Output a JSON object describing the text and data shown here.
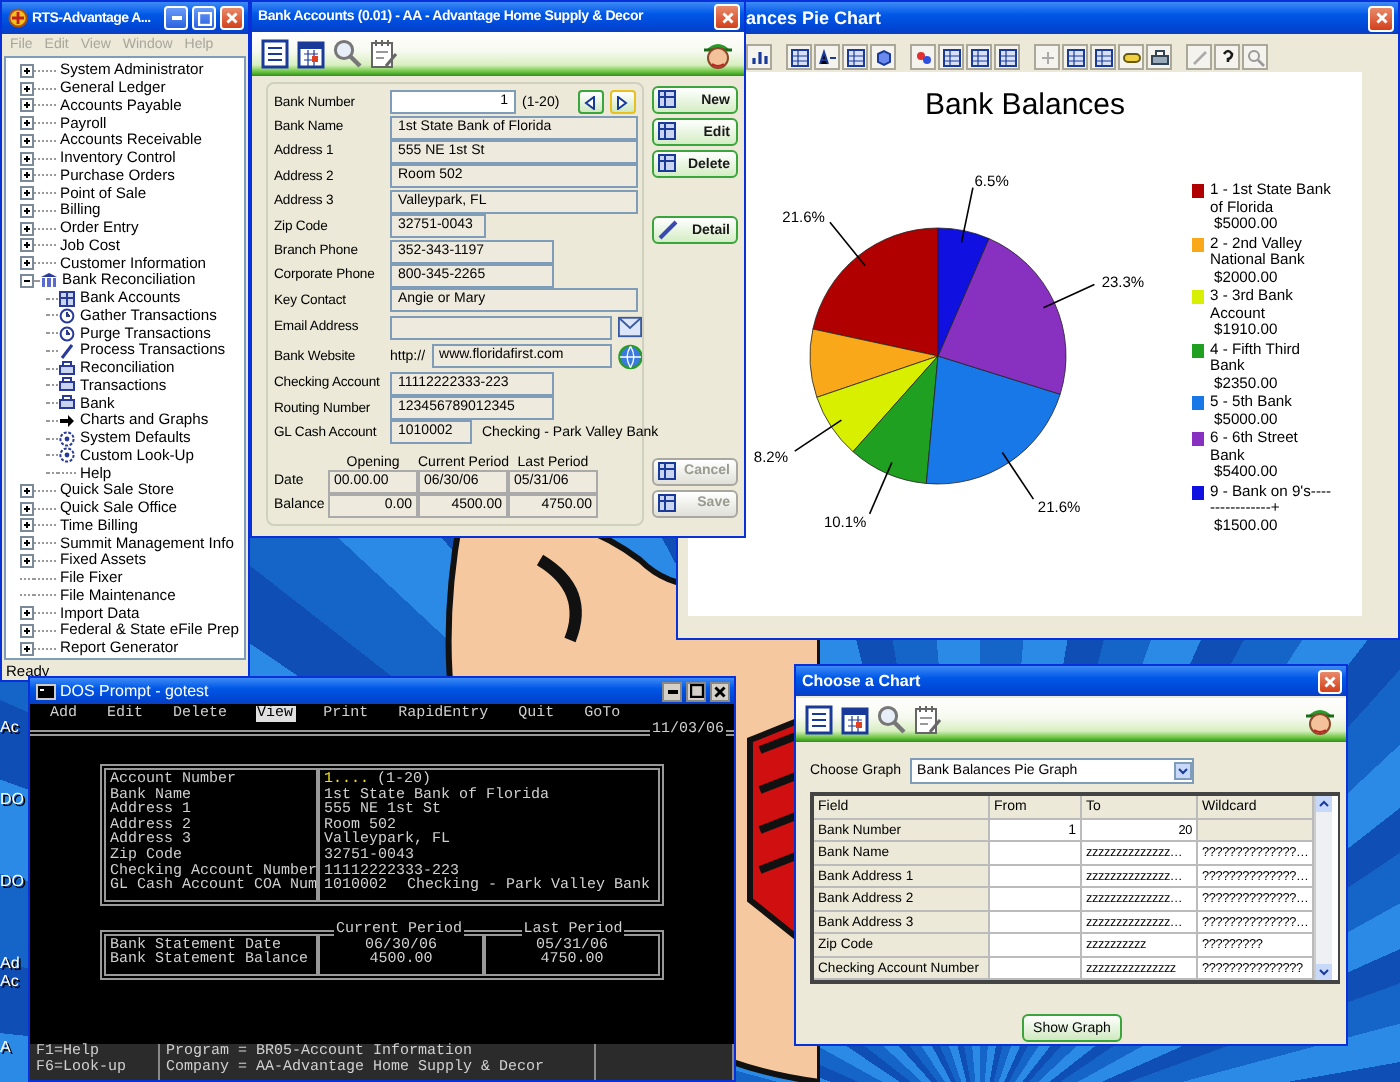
{
  "desktop_icons": [
    {
      "label": "Ac"
    },
    {
      "label": "DO"
    },
    {
      "label": "DO"
    },
    {
      "label": "Ad"
    },
    {
      "label": "Ac"
    },
    {
      "label": "A"
    }
  ],
  "main_window": {
    "title": "RTS-Advantage A...",
    "menu": [
      {
        "label": "File",
        "disabled": true
      },
      {
        "label": "Edit",
        "disabled": true
      },
      {
        "label": "View",
        "disabled": true
      },
      {
        "label": "Window",
        "disabled": true
      },
      {
        "label": "Help",
        "disabled": true
      }
    ],
    "tree": [
      {
        "label": "System Administrator",
        "kind": "folder",
        "expanded": false
      },
      {
        "label": "General Ledger",
        "kind": "folder",
        "expanded": false
      },
      {
        "label": "Accounts Payable",
        "kind": "folder",
        "expanded": false
      },
      {
        "label": "Payroll",
        "kind": "folder",
        "expanded": false
      },
      {
        "label": "Accounts Receivable",
        "kind": "folder",
        "expanded": false
      },
      {
        "label": "Inventory Control",
        "kind": "folder",
        "expanded": false
      },
      {
        "label": "Purchase Orders",
        "kind": "folder",
        "expanded": false
      },
      {
        "label": "Point of Sale",
        "kind": "folder",
        "expanded": false
      },
      {
        "label": "Billing",
        "kind": "folder",
        "expanded": false
      },
      {
        "label": "Order Entry",
        "kind": "folder",
        "expanded": false
      },
      {
        "label": "Job Cost",
        "kind": "folder",
        "expanded": false
      },
      {
        "label": "Customer Information",
        "kind": "folder",
        "expanded": false
      },
      {
        "label": "Bank Reconciliation",
        "kind": "folder",
        "expanded": true,
        "children": [
          {
            "label": "Bank Accounts"
          },
          {
            "label": "Gather Transactions"
          },
          {
            "label": "Purge Transactions"
          },
          {
            "label": "Process Transactions"
          },
          {
            "label": "Reconciliation"
          },
          {
            "label": "Transactions"
          },
          {
            "label": "Bank"
          },
          {
            "label": "Charts and Graphs"
          },
          {
            "label": "System Defaults"
          },
          {
            "label": "Custom Look-Up"
          },
          {
            "label": "Help"
          }
        ]
      },
      {
        "label": "Quick Sale Store",
        "kind": "folder",
        "expanded": false
      },
      {
        "label": "Quick Sale Office",
        "kind": "folder",
        "expanded": false
      },
      {
        "label": "Time Billing",
        "kind": "folder",
        "expanded": false
      },
      {
        "label": "Summit Management Info",
        "kind": "folder",
        "expanded": false
      },
      {
        "label": "Fixed Assets",
        "kind": "folder",
        "expanded": false
      },
      {
        "label": "File Fixer",
        "kind": "leaf",
        "expanded": false
      },
      {
        "label": "File Maintenance",
        "kind": "leaf",
        "expanded": false
      },
      {
        "label": "Import Data",
        "kind": "folder",
        "expanded": false
      },
      {
        "label": "Federal & State eFile Prep",
        "kind": "folder",
        "expanded": false
      },
      {
        "label": "Report Generator",
        "kind": "folder",
        "expanded": false
      }
    ],
    "status": "Ready"
  },
  "bank_window": {
    "title": "Bank Accounts (0.01) - AA - Advantage Home Supply & Decor",
    "fields": [
      {
        "kind": "number",
        "label": "Bank Number",
        "value": "1",
        "range": "(1-20)"
      },
      {
        "kind": "text",
        "label": "Bank Name",
        "value": "1st State Bank of Florida"
      },
      {
        "kind": "text",
        "label": "Address 1",
        "value": "555 NE 1st St"
      },
      {
        "kind": "text",
        "label": "Address 2",
        "value": "Room 502"
      },
      {
        "kind": "text",
        "label": "Address 3",
        "value": "Valleypark, FL"
      },
      {
        "kind": "short",
        "label": "Zip Code",
        "value": "32751-0043"
      },
      {
        "kind": "medium",
        "label": "Branch Phone",
        "value": "352-343-1197"
      },
      {
        "kind": "medium",
        "label": "Corporate Phone",
        "value": "800-345-2265"
      },
      {
        "kind": "text",
        "label": "Key Contact",
        "value": "Angie or Mary"
      },
      {
        "kind": "email",
        "label": "Email Address"
      },
      {
        "kind": "website",
        "label": "Bank Website",
        "prefix": "http://",
        "value": "www.floridafirst.com"
      },
      {
        "kind": "medium",
        "label": "Checking Account",
        "value": "11112222333-223"
      },
      {
        "kind": "medium",
        "label": "Routing Number",
        "value": "123456789012345"
      },
      {
        "kind": "account",
        "label": "GL Cash Account",
        "value": "1010002",
        "note": "Checking - Park Valley Bank"
      }
    ],
    "buttons": [
      {
        "label": "New",
        "disabled": false
      },
      {
        "label": "Edit",
        "disabled": false
      },
      {
        "label": "Delete",
        "disabled": false
      },
      {
        "label": "Detail",
        "disabled": false
      }
    ],
    "period_table": {
      "columns": [
        "Opening",
        "Current Period",
        "Last Period"
      ],
      "rows": [
        {
          "label": "Date",
          "values": [
            "00.00.00",
            "06/30/06",
            "05/31/06"
          ]
        },
        {
          "label": "Balance",
          "values": [
            "0.00",
            "4500.00",
            "4750.00"
          ]
        }
      ]
    },
    "footer_buttons": [
      {
        "label": "Cancel",
        "disabled": true
      },
      {
        "label": "Save",
        "disabled": true
      }
    ]
  },
  "chart_window": {
    "title": "ances Pie Chart",
    "chart_data": {
      "type": "pie",
      "title": "Bank Balances",
      "categories": [
        "1 - 1st State Bank of Florida",
        "2 - 2nd Valley National Bank",
        "3 - 3rd Bank Account",
        "4 - Fifth Third Bank",
        "5 - 5th Bank",
        "6 - 6th Street Bank",
        "9 - Bank on 9's----------------+"
      ],
      "values": [
        21.6,
        8.6,
        8.2,
        10.1,
        21.6,
        23.3,
        6.5
      ],
      "value_labels": [
        "21.6%",
        null,
        "8.2%",
        "10.1%",
        "21.6%",
        "23.3%",
        "6.5%"
      ]
    },
    "legend": [
      {
        "color": "#b00000",
        "amount": "$5000.00"
      },
      {
        "color": "#f8a818",
        "amount": "$2000.00"
      },
      {
        "color": "#d8f000",
        "amount": "$1910.00"
      },
      {
        "color": "#20a020",
        "amount": "$2350.00"
      },
      {
        "color": "#1878e8",
        "amount": "$5000.00"
      },
      {
        "color": "#8830c0",
        "amount": "$5400.00"
      },
      {
        "color": "#1010e0",
        "amount": "$1500.00"
      }
    ]
  },
  "dos_window": {
    "title": "DOS Prompt - gotest",
    "menu": [
      {
        "label": "Add",
        "selected": false
      },
      {
        "label": "Edit",
        "selected": false
      },
      {
        "label": "Delete",
        "selected": false
      },
      {
        "label": "View",
        "selected": true
      },
      {
        "label": "Print",
        "selected": false
      },
      {
        "label": "RapidEntry",
        "selected": false
      },
      {
        "label": "Quit",
        "selected": false
      },
      {
        "label": "GoTo",
        "selected": false
      }
    ],
    "date": "11/03/06",
    "record": [
      {
        "label": "Account Number",
        "value": "1....",
        "note": "(1-20)",
        "active": true
      },
      {
        "label": "Bank Name",
        "value": "1st State Bank of Florida",
        "active": false
      },
      {
        "label": "Address 1",
        "value": "555 NE 1st St",
        "active": false
      },
      {
        "label": "Address 2",
        "value": "Room 502",
        "active": false
      },
      {
        "label": "Address 3",
        "value": "Valleypark, FL",
        "active": false
      },
      {
        "label": "Zip Code",
        "value": "32751-0043",
        "active": false
      },
      {
        "label": "Checking Account Number",
        "value": "11112222333-223",
        "active": false
      },
      {
        "label": "GL Cash Account COA Num",
        "value": "1010002",
        "note": "Checking - Park Valley Bank",
        "active": false
      }
    ],
    "statement": {
      "columns": [
        "Current Period",
        "Last Period"
      ],
      "rows": [
        {
          "label": "Bank Statement Date",
          "values": [
            "06/30/06",
            "05/31/06"
          ]
        },
        {
          "label": "Bank Statement Balance",
          "values": [
            "4500.00",
            "4750.00"
          ]
        }
      ]
    },
    "keys": [
      "F1=Help",
      "F6=Look-up"
    ],
    "info": [
      "Program = BR05-Account Information",
      "Company = AA-Advantage Home Supply & Decor"
    ]
  },
  "choose_chart_window": {
    "title": "Choose a Chart",
    "graph_label": "Choose Graph",
    "graph_value": "Bank Balances Pie Graph",
    "columns": [
      "Field",
      "From",
      "To",
      "Wildcard"
    ],
    "rows": [
      {
        "field": "Bank Number",
        "from": "1",
        "to": "20"
      },
      {
        "field": "Bank Name",
        "to": "zzzzzzzzzzzzzz…",
        "wildcard": "??????????????…"
      },
      {
        "field": "Bank Address 1",
        "to": "zzzzzzzzzzzzzz…",
        "wildcard": "??????????????…"
      },
      {
        "field": "Bank Address 2",
        "to": "zzzzzzzzzzzzzz…",
        "wildcard": "??????????????…"
      },
      {
        "field": "Bank Address 3",
        "to": "zzzzzzzzzzzzzz…",
        "wildcard": "??????????????…"
      },
      {
        "field": "Zip Code",
        "to": "zzzzzzzzzz",
        "wildcard": "?????????"
      },
      {
        "field": "Checking Account Number",
        "to": "zzzzzzzzzzzzzzz",
        "wildcard": "???????????????"
      }
    ],
    "button": "Show Graph"
  }
}
